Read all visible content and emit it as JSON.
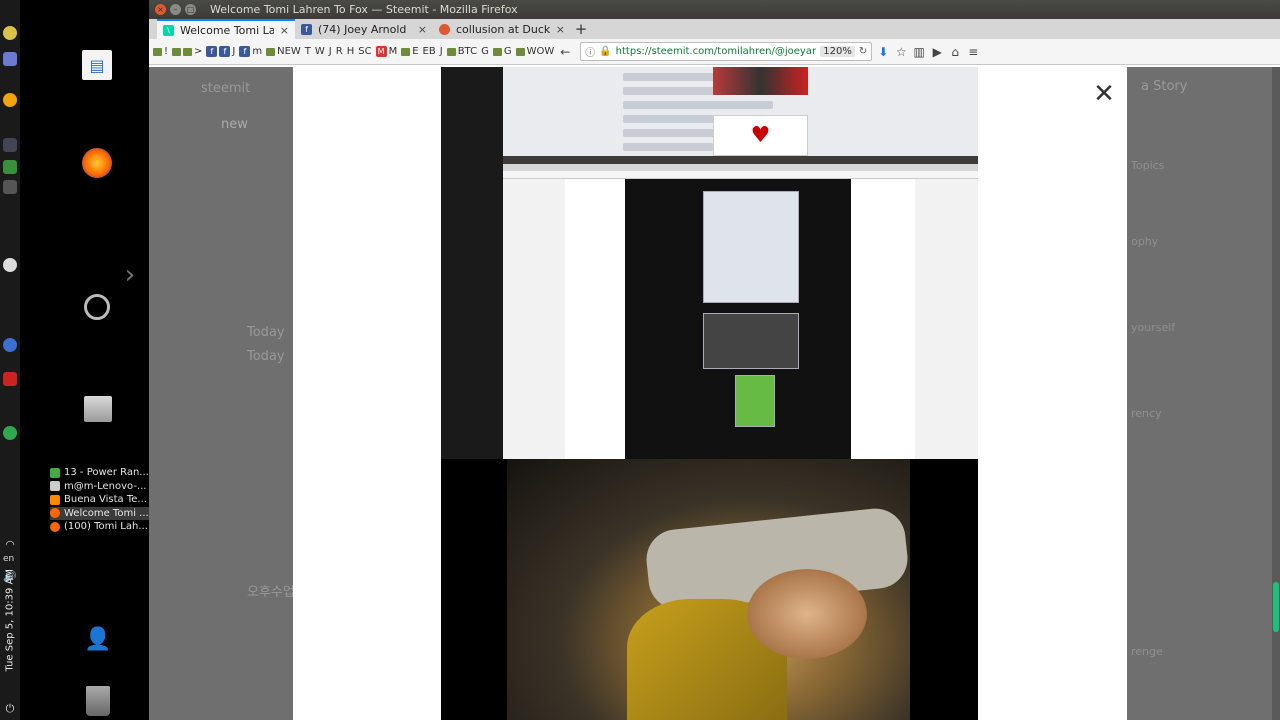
{
  "window": {
    "title": "Welcome Tomi Lahren To Fox — Steemit - Mozilla Firefox"
  },
  "tabs": [
    {
      "label": "Welcome Tomi Lahren",
      "favicon": "steemit-icon",
      "selected": true
    },
    {
      "label": "(74) Joey Arnold",
      "favicon": "facebook-icon",
      "selected": false
    },
    {
      "label": "collusion at DuckDuck",
      "favicon": "duckduckgo-icon",
      "selected": false
    }
  ],
  "bookmarks": [
    "!",
    ">",
    "J",
    "m",
    "NEW",
    "T",
    "W",
    "J",
    "R",
    "H",
    "SC",
    "M",
    "E",
    "EB",
    "J",
    "BTC",
    "G",
    "G",
    "WOW"
  ],
  "urlbar": {
    "url": "https://steemit.com/tomilahren/@joeyarnold/",
    "zoom": "120%"
  },
  "desktop": {
    "window_list": [
      {
        "label": "13 - Power Ran...",
        "active": false
      },
      {
        "label": "m@m-Lenovo-...",
        "active": false
      },
      {
        "label": "Buena Vista Te...",
        "active": false
      },
      {
        "label": "Welcome Tomi ...",
        "active": true
      },
      {
        "label": "(100) Tomi Lah...",
        "active": false
      }
    ]
  },
  "panel": {
    "clock": "Tue Sep 5, 10:39 AM",
    "language": "en"
  },
  "page": {
    "ghost_texts": [
      "steemit",
      "new",
      "Today",
      "Today",
      "오후수업",
      "a Story",
      "Topics",
      "ophy",
      "yourself",
      "rency",
      "renge"
    ],
    "close_glyph": "✕"
  },
  "colors": {
    "tab_accent": "#0a84ff",
    "url_green": "#0a7b37",
    "scroll_thumb": "#19c37d"
  }
}
